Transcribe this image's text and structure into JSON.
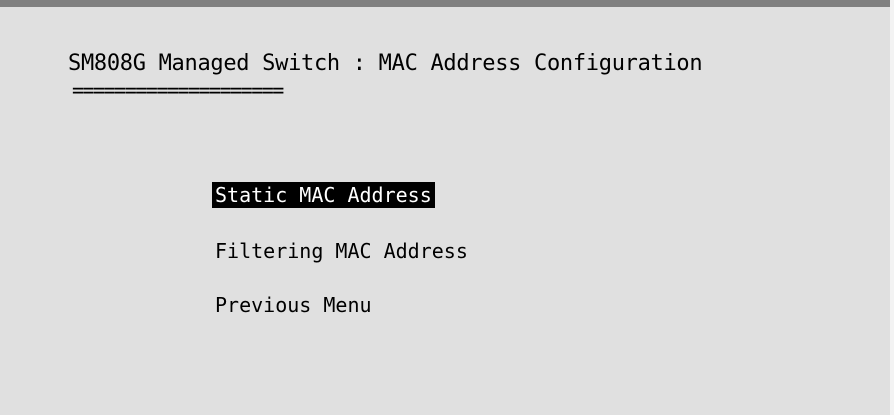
{
  "header": {
    "title": "SM808G Managed Switch : MAC Address Configuration",
    "underline": "===================="
  },
  "menu": {
    "items": [
      {
        "label": "Static MAC Address",
        "selected": true
      },
      {
        "label": "Filtering MAC Address",
        "selected": false
      },
      {
        "label": "Previous Menu",
        "selected": false
      }
    ]
  },
  "colors": {
    "background": "#e0e0e0",
    "text": "#000000",
    "highlight_bg": "#000000",
    "highlight_text": "#ffffff"
  }
}
